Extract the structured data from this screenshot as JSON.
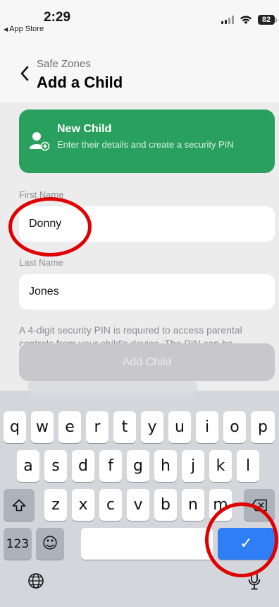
{
  "status_bar": {
    "time": "2:29",
    "back_app": "App Store",
    "battery": "82"
  },
  "nav": {
    "parent": "Safe Zones",
    "title": "Add a Child"
  },
  "banner": {
    "title": "New Child",
    "subtitle": "Enter their details and create a security PIN",
    "icon": "add-person-icon"
  },
  "form": {
    "first_name_label": "First Name",
    "first_name_value": "Donny",
    "last_name_label": "Last Name",
    "last_name_value": "Jones",
    "pin_info": "A 4-digit security PIN is required to access parental controls from your child's device. The PIN can be",
    "add_button": "Add Child"
  },
  "keyboard": {
    "row1": [
      "q",
      "w",
      "e",
      "r",
      "t",
      "y",
      "u",
      "i",
      "o",
      "p"
    ],
    "row2": [
      "a",
      "s",
      "d",
      "f",
      "g",
      "h",
      "j",
      "k",
      "l"
    ],
    "row3": [
      "z",
      "x",
      "c",
      "v",
      "b",
      "n",
      "m"
    ],
    "numbers_key": "123",
    "emoji_key": "☺",
    "return_key": "✓",
    "shift_icon": "shift-icon",
    "delete_icon": "delete-icon",
    "globe_icon": "globe-icon",
    "mic_icon": "microphone-icon"
  },
  "colors": {
    "banner_green": "#2aa05f",
    "return_blue": "#2f7ef6",
    "annotation_red": "#e00000",
    "disabled_button": "#c7c7cc"
  }
}
